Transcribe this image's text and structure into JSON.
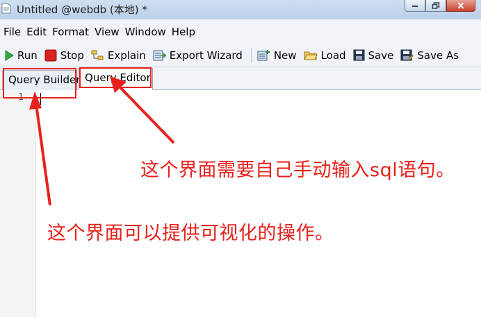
{
  "window": {
    "title": "Untitled @webdb (本地) *",
    "controls": [
      "minimize-icon",
      "restore-icon",
      "close-icon"
    ]
  },
  "menu": {
    "items": [
      "File",
      "Edit",
      "Format",
      "View",
      "Window",
      "Help"
    ]
  },
  "toolbar": {
    "run": "Run",
    "stop": "Stop",
    "explain": "Explain",
    "export_wizard": "Export Wizard",
    "new": "New",
    "load": "Load",
    "save": "Save",
    "save_as": "Save As"
  },
  "tabs": [
    {
      "label": "Query Builder",
      "active": false
    },
    {
      "label": "Query Editor",
      "active": true
    }
  ],
  "editor": {
    "line_numbers": [
      "1"
    ]
  },
  "annotations": {
    "editor_note": "这个界面需要自己手动输入sql语句。",
    "builder_note": "这个界面可以提供可视化的操作。",
    "color": "#e8211b"
  }
}
